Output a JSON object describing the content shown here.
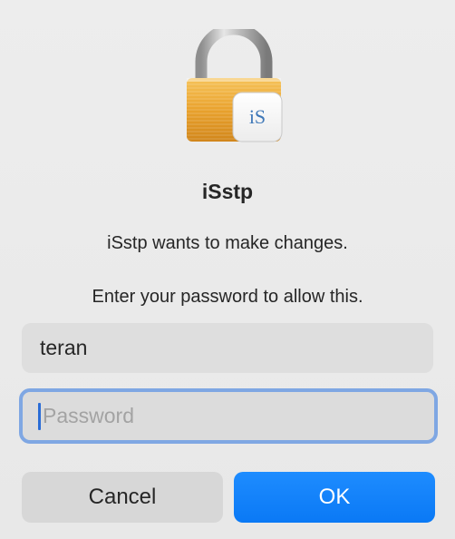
{
  "dialog": {
    "app_title": "iSstp",
    "message": "iSstp wants to make changes.",
    "instruction": "Enter your password to allow this.",
    "app_badge_text": "iS",
    "username": {
      "value": "teran"
    },
    "password": {
      "value": "",
      "placeholder": "Password"
    },
    "buttons": {
      "cancel_label": "Cancel",
      "ok_label": "OK"
    }
  },
  "colors": {
    "accent": "#0a79f5",
    "focus_ring": "#7fa7e3",
    "lock_gold": "#e8a12c"
  },
  "icons": {
    "lock": "padlock-icon",
    "app_badge": "isstp-app-icon"
  }
}
